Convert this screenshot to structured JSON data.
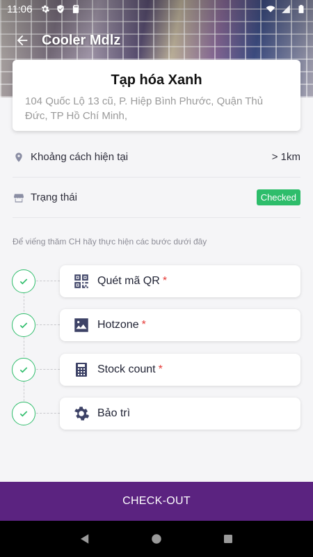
{
  "status_bar": {
    "time": "11:06",
    "left_icons": [
      "gear-icon",
      "shield-icon",
      "sd-card-icon"
    ],
    "right_icons": [
      "wifi-icon",
      "signal-icon",
      "battery-icon"
    ]
  },
  "app_bar": {
    "title": "Cooler Mdlz",
    "back_icon": "arrow-left-icon"
  },
  "store": {
    "name": "Tạp hóa Xanh",
    "address": "104 Quốc Lộ 13 cũ, P. Hiệp Bình Phước, Quận Thủ Đức, TP Hồ Chí Minh,"
  },
  "info": {
    "distance_label": "Khoảng cách hiện tại",
    "distance_value": "> 1km",
    "status_label": "Trạng thái",
    "status_value": "Checked"
  },
  "instruction": "Để viếng thăm CH hãy thực hiện các bước dưới đây",
  "steps": [
    {
      "label": "Quét mã QR",
      "required": "*",
      "icon": "qr-code-icon",
      "done": true
    },
    {
      "label": "Hotzone",
      "required": "*",
      "icon": "image-icon",
      "done": true
    },
    {
      "label": "Stock count",
      "required": "*",
      "icon": "calculator-icon",
      "done": true
    },
    {
      "label": "Bảo trì",
      "required": "",
      "icon": "gear-icon",
      "done": true
    }
  ],
  "checkout_label": "CHECK-OUT",
  "nav": [
    "back-triangle-icon",
    "home-circle-icon",
    "recents-square-icon"
  ],
  "colors": {
    "primary": "#5b2380",
    "success": "#2ebd6b",
    "required": "#e53935",
    "icon": "#3d4266"
  }
}
